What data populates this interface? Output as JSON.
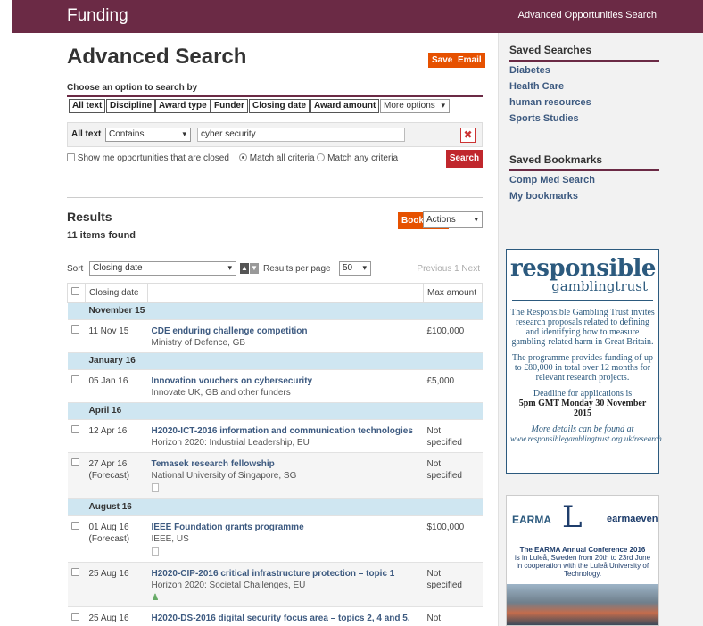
{
  "header": {
    "brand": "Funding",
    "top_link": "Advanced Opportunities Search"
  },
  "page": {
    "title": "Advanced Search",
    "save_label": "Save",
    "email_label": "Email",
    "choose_label": "Choose an option to search by"
  },
  "search_options": [
    "All text",
    "Discipline",
    "Award type",
    "Funder",
    "Closing date",
    "Award amount"
  ],
  "more_options": "More options",
  "criteria": {
    "label": "All text",
    "operator": "Contains",
    "value": "cyber security"
  },
  "filters": {
    "show_closed": "Show me opportunities that are closed",
    "match_all": "Match all criteria",
    "match_any": "Match any criteria",
    "search_label": "Search"
  },
  "results": {
    "title": "Results",
    "count": "11 items found",
    "bookmark_label": "Bookmark",
    "actions_label": "Actions",
    "sort_label": "Sort",
    "sort_value": "Closing date",
    "per_page_label": "Results per page",
    "per_page_value": "50",
    "pager": "Previous 1 Next",
    "columns": [
      "Closing date",
      "",
      "Max amount"
    ],
    "groups": [
      {
        "label": "November 15",
        "rows": [
          {
            "date": "11 Nov 15",
            "date2": "",
            "title": "CDE enduring challenge competition",
            "funder": "Ministry of Defence, GB",
            "amount": "£100,000",
            "amount2": ""
          }
        ]
      },
      {
        "label": "January 16",
        "rows": [
          {
            "date": "05 Jan 16",
            "date2": "",
            "title": "Innovation vouchers on cybersecurity",
            "funder": "Innovate UK, GB and other funders",
            "amount": "£5,000",
            "amount2": ""
          }
        ]
      },
      {
        "label": "April 16",
        "rows": [
          {
            "date": "12 Apr 16",
            "date2": "",
            "title": "H2020-ICT-2016 information and communication technologies",
            "funder": "Horizon 2020: Industrial Leadership, EU",
            "amount": "Not",
            "amount2": "specified"
          },
          {
            "date": "27 Apr 16",
            "date2": "(Forecast)",
            "title": "Temasek research fellowship",
            "funder": "National University of Singapore, SG",
            "amount": "Not",
            "amount2": "specified"
          }
        ]
      },
      {
        "label": "August 16",
        "rows": [
          {
            "date": "01 Aug 16",
            "date2": "(Forecast)",
            "title": "IEEE Foundation grants programme",
            "funder": "IEEE, US",
            "amount": "$100,000",
            "amount2": ""
          },
          {
            "date": "25 Aug 16",
            "date2": "",
            "title": "H2020-CIP-2016 critical infrastructure protection – topic 1",
            "funder": "Horizon 2020: Societal Challenges, EU",
            "amount": "Not",
            "amount2": "specified"
          },
          {
            "date": "25 Aug 16",
            "date2": "",
            "title": "H2020-DS-2016 digital security focus area – topics 2, 4 and 5,",
            "funder": "",
            "amount": "Not",
            "amount2": ""
          }
        ]
      }
    ]
  },
  "sidebar": {
    "saved_searches_title": "Saved Searches",
    "saved_searches": [
      "Diabetes",
      "Health Care",
      "human resources",
      "Sports Studies"
    ],
    "saved_bookmarks_title": "Saved Bookmarks",
    "saved_bookmarks": [
      "Comp Med Search",
      "My bookmarks"
    ]
  },
  "ad_rgt": {
    "logo_main": "responsible",
    "logo_sub": "gamblingtrust",
    "p1": "The Responsible Gambling Trust invites research proposals related to defining and identifying how to measure gambling-related harm in Great Britain.",
    "p2": "The programme provides funding of up to £80,000 in total over 12 months for relevant research projects.",
    "p3a": "Deadline for applications is",
    "p3b": "5pm GMT Monday 30 November 2015",
    "p4a": "More details can be found at",
    "p4b": "www.responsiblegamblingtrust.org.uk/research"
  },
  "ad_earma": {
    "logo_left": "EARMA",
    "logo_mid": "L",
    "logo_right": "earmaevents",
    "conf_title": "The EARMA Annual Conference 2016",
    "conf_text": "is in Luleå, Sweden from 20th to 23rd June in cooperation with the Luleå University of Technology."
  },
  "colors": {
    "brand": "#6b2a45",
    "accent_orange": "#e65100",
    "search_red": "#c0272d",
    "link": "#3d5a80",
    "group_band": "#cfe6f1"
  }
}
